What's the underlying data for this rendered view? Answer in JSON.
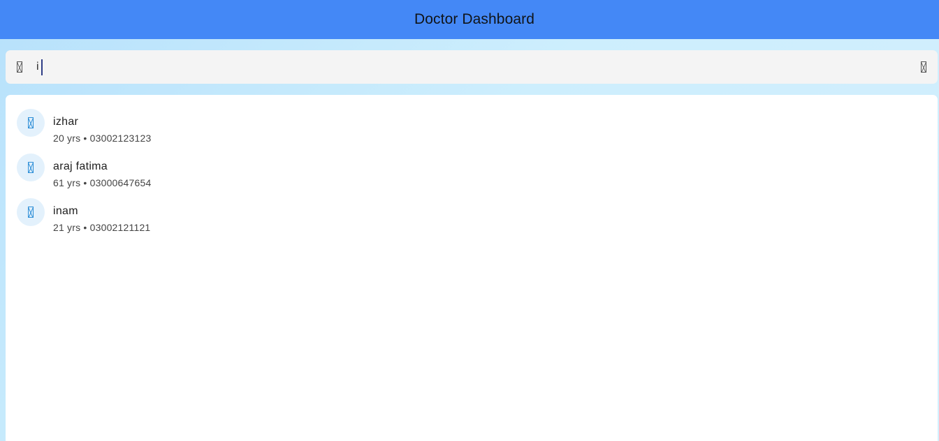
{
  "appbar": {
    "title": "Doctor Dashboard",
    "color": "#4488f6"
  },
  "search": {
    "value": "i",
    "icon": "search-icon",
    "clear_icon": "clear-icon"
  },
  "patients": [
    {
      "name": "izhar",
      "meta": "20 yrs • 03002123123",
      "icon": "person-icon"
    },
    {
      "name": "araj fatima",
      "meta": "61 yrs • 03000647654",
      "icon": "person-icon"
    },
    {
      "name": "inam",
      "meta": "21 yrs • 03002121121",
      "icon": "person-icon"
    }
  ]
}
